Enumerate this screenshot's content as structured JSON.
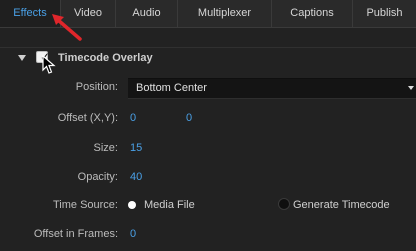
{
  "tabs": [
    "Effects",
    "Video",
    "Audio",
    "Multiplexer",
    "Captions",
    "Publish"
  ],
  "active_tab": "Effects",
  "section": {
    "title": "Timecode Overlay",
    "enabled": true
  },
  "fields": {
    "position": {
      "label": "Position:",
      "value": "Bottom Center"
    },
    "offset": {
      "label": "Offset (X,Y):",
      "x": "0",
      "y": "0"
    },
    "size": {
      "label": "Size:",
      "value": "15"
    },
    "opacity": {
      "label": "Opacity:",
      "value": "40"
    },
    "time_source": {
      "label": "Time Source:",
      "options": [
        "Media File",
        "Generate Timecode"
      ],
      "selected": "Media File"
    },
    "offset_frames": {
      "label": "Offset in Frames:",
      "value": "0"
    }
  },
  "colors": {
    "accent": "#4aa0e6",
    "annotation_arrow": "#e0262b"
  }
}
